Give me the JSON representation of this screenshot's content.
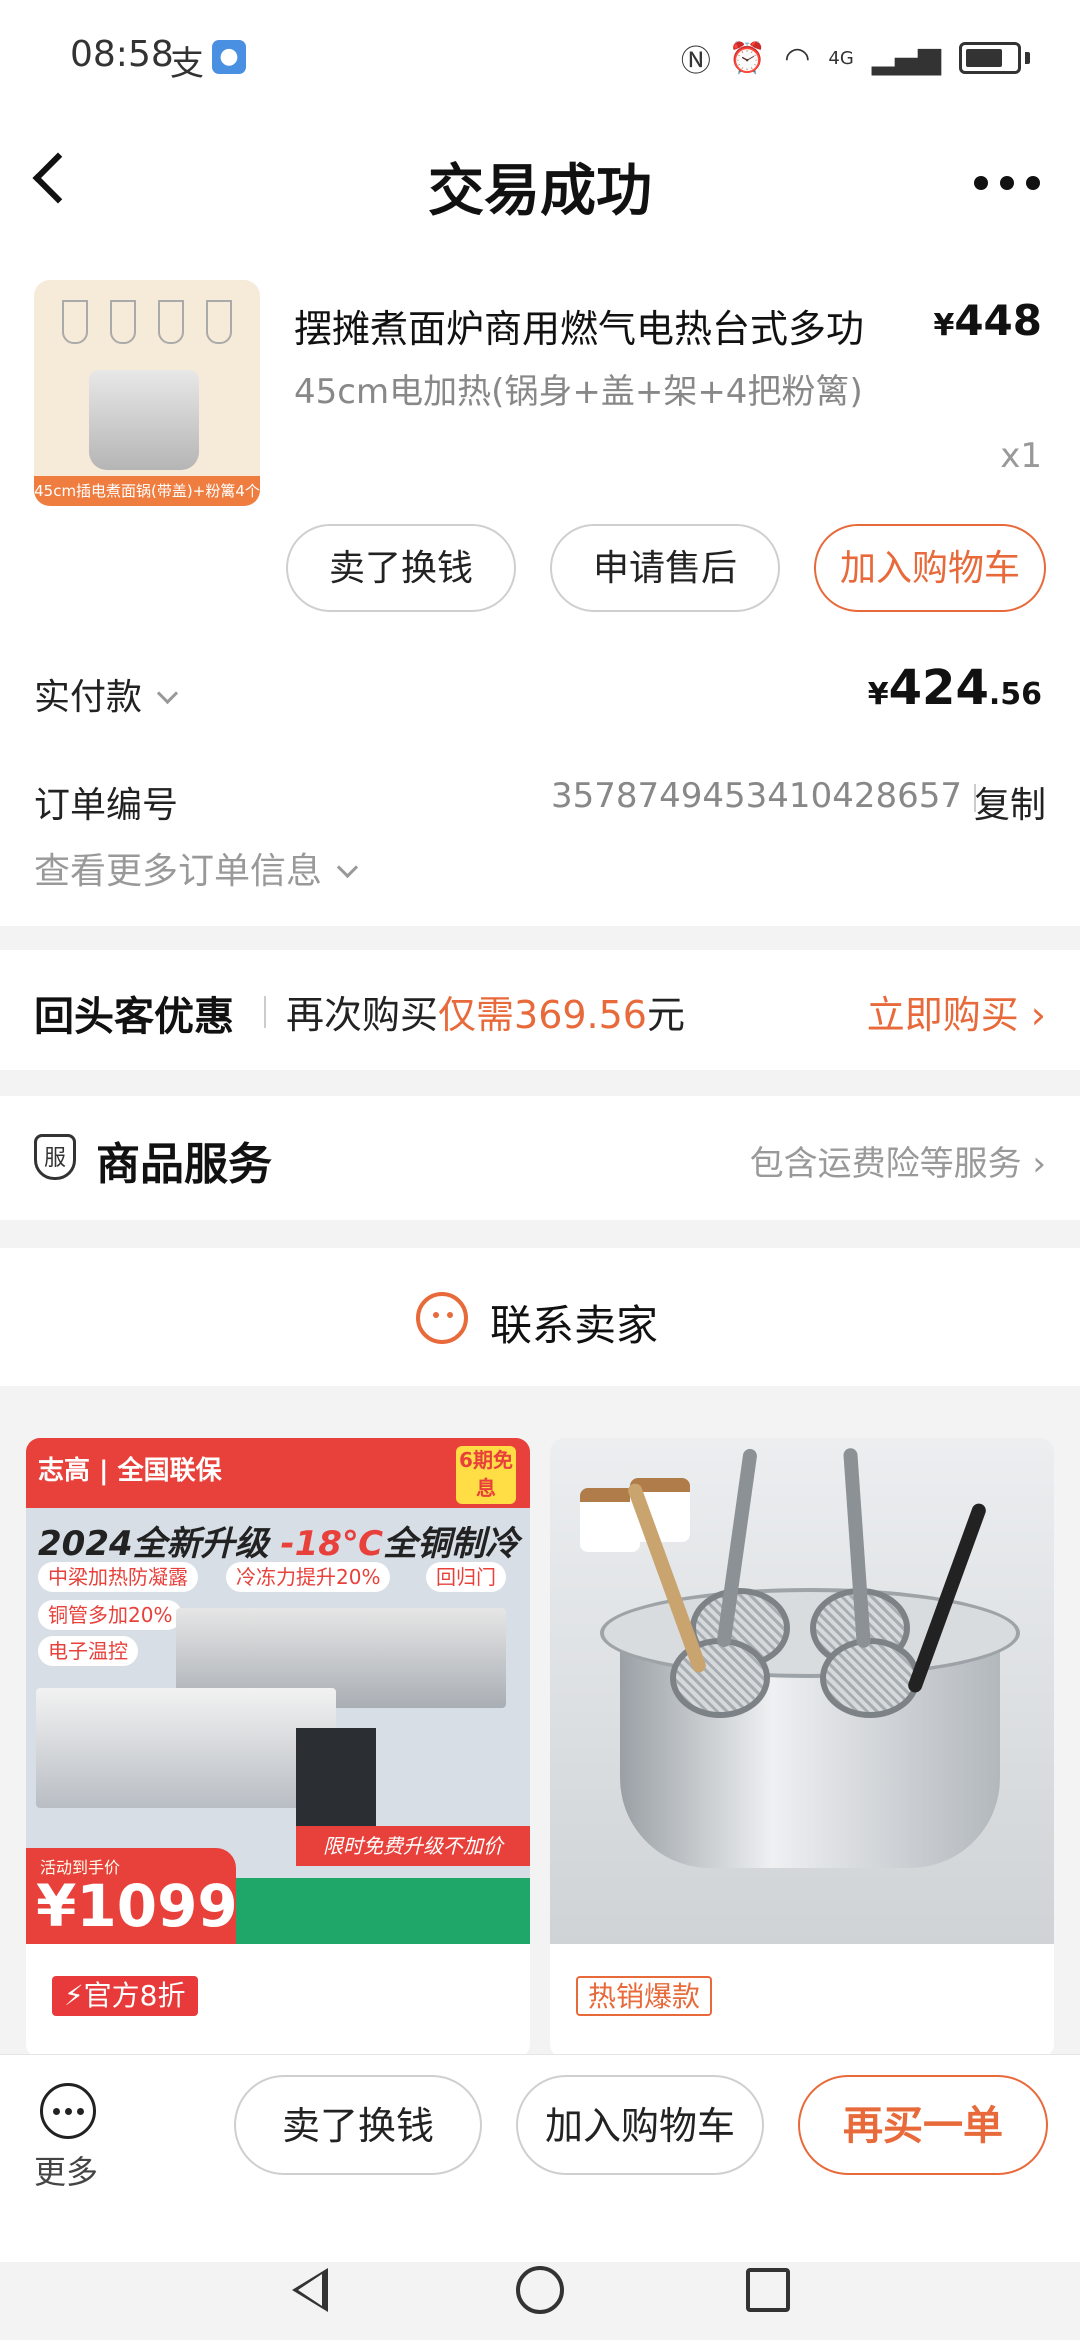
{
  "status_bar": {
    "time": "08:58",
    "alipay_glyph": "支",
    "network": "4G"
  },
  "header": {
    "title": "交易成功"
  },
  "product": {
    "thumb_label": "45cm插电煮面锅(带盖)+粉篱4个",
    "title": "摆摊煮面炉商用燃气电热台式多功",
    "price_symbol": "¥",
    "price": "448",
    "spec": "45cm电加热(锅身+盖+架+4把粉篱)",
    "quantity": "x1"
  },
  "item_actions": {
    "sell": "卖了换钱",
    "after_sale": "申请售后",
    "add_cart": "加入购物车"
  },
  "payment": {
    "label": "实付款",
    "symbol": "¥",
    "amount_int": "424",
    "amount_dec": ".56"
  },
  "order": {
    "label": "订单编号",
    "number": "3578749453410428657",
    "copy": "复制",
    "more_info": "查看更多订单信息"
  },
  "returning": {
    "title": "回头客优惠",
    "text_prefix": "再次购买",
    "text_highlight": "仅需369.56",
    "text_suffix": "元",
    "buy_now": "立即购买"
  },
  "service": {
    "icon_text": "服",
    "title": "商品服务",
    "right_text": "包含运费险等服务"
  },
  "contact": {
    "label": "联系卖家"
  },
  "recommendations": [
    {
      "brand": "志高 | 全国联保",
      "tag": "6期免息",
      "headline_prefix": "2024全新升级 ",
      "headline_red": "-18℃",
      "headline_suffix": "全铜制冷",
      "chips": [
        "中梁加热防凝露",
        "冷冻力提升20%",
        "回归门",
        "铜管多加20%",
        "电子温控"
      ],
      "promo": "限时免费升级不加价",
      "price_caption": "活动到手价",
      "price": "¥1099",
      "badge": "官方8折"
    },
    {
      "badge": "热销爆款"
    }
  ],
  "bottom_bar": {
    "more": "更多",
    "sell": "卖了换钱",
    "add_cart": "加入购物车",
    "buy_again": "再买一单"
  }
}
